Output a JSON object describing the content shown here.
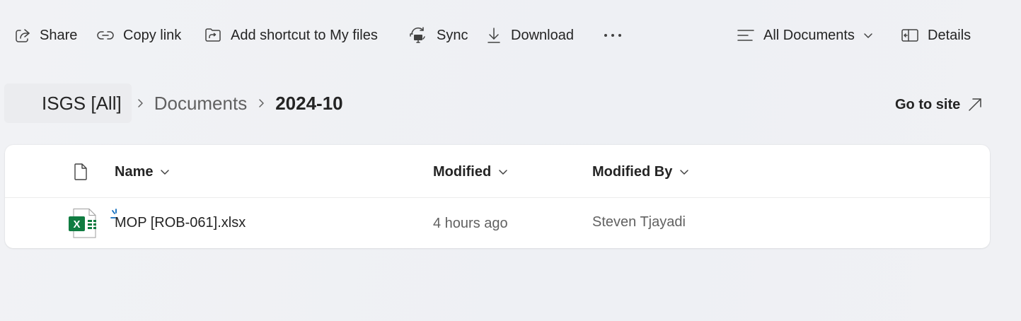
{
  "toolbar": {
    "share_label": "Share",
    "copy_link_label": "Copy link",
    "add_shortcut_label": "Add shortcut to My files",
    "sync_label": "Sync",
    "download_label": "Download",
    "more_label": "...",
    "view_label": "All Documents",
    "details_label": "Details",
    "icons": [
      "share-icon",
      "link-icon",
      "add-shortcut-icon",
      "sync-icon",
      "download-icon",
      "more-icon",
      "view-list-icon",
      "chevron-down-icon",
      "details-pane-icon"
    ]
  },
  "breadcrumb": {
    "items": [
      "ISGS [All]",
      "Documents",
      "2024-10"
    ]
  },
  "goto_site_label": "Go to site",
  "table": {
    "columns": [
      "Name",
      "Modified",
      "Modified By"
    ],
    "rows": [
      {
        "name": "MOP [ROB-061].xlsx",
        "modified": "4 hours ago",
        "modified_by": "Steven Tjayadi",
        "file_type": "excel-file-icon"
      }
    ]
  },
  "colors": {
    "text_primary": "#242424",
    "text_secondary": "#616161",
    "excel_green": "#107c41",
    "sync_blue": "#0f6cbd"
  }
}
